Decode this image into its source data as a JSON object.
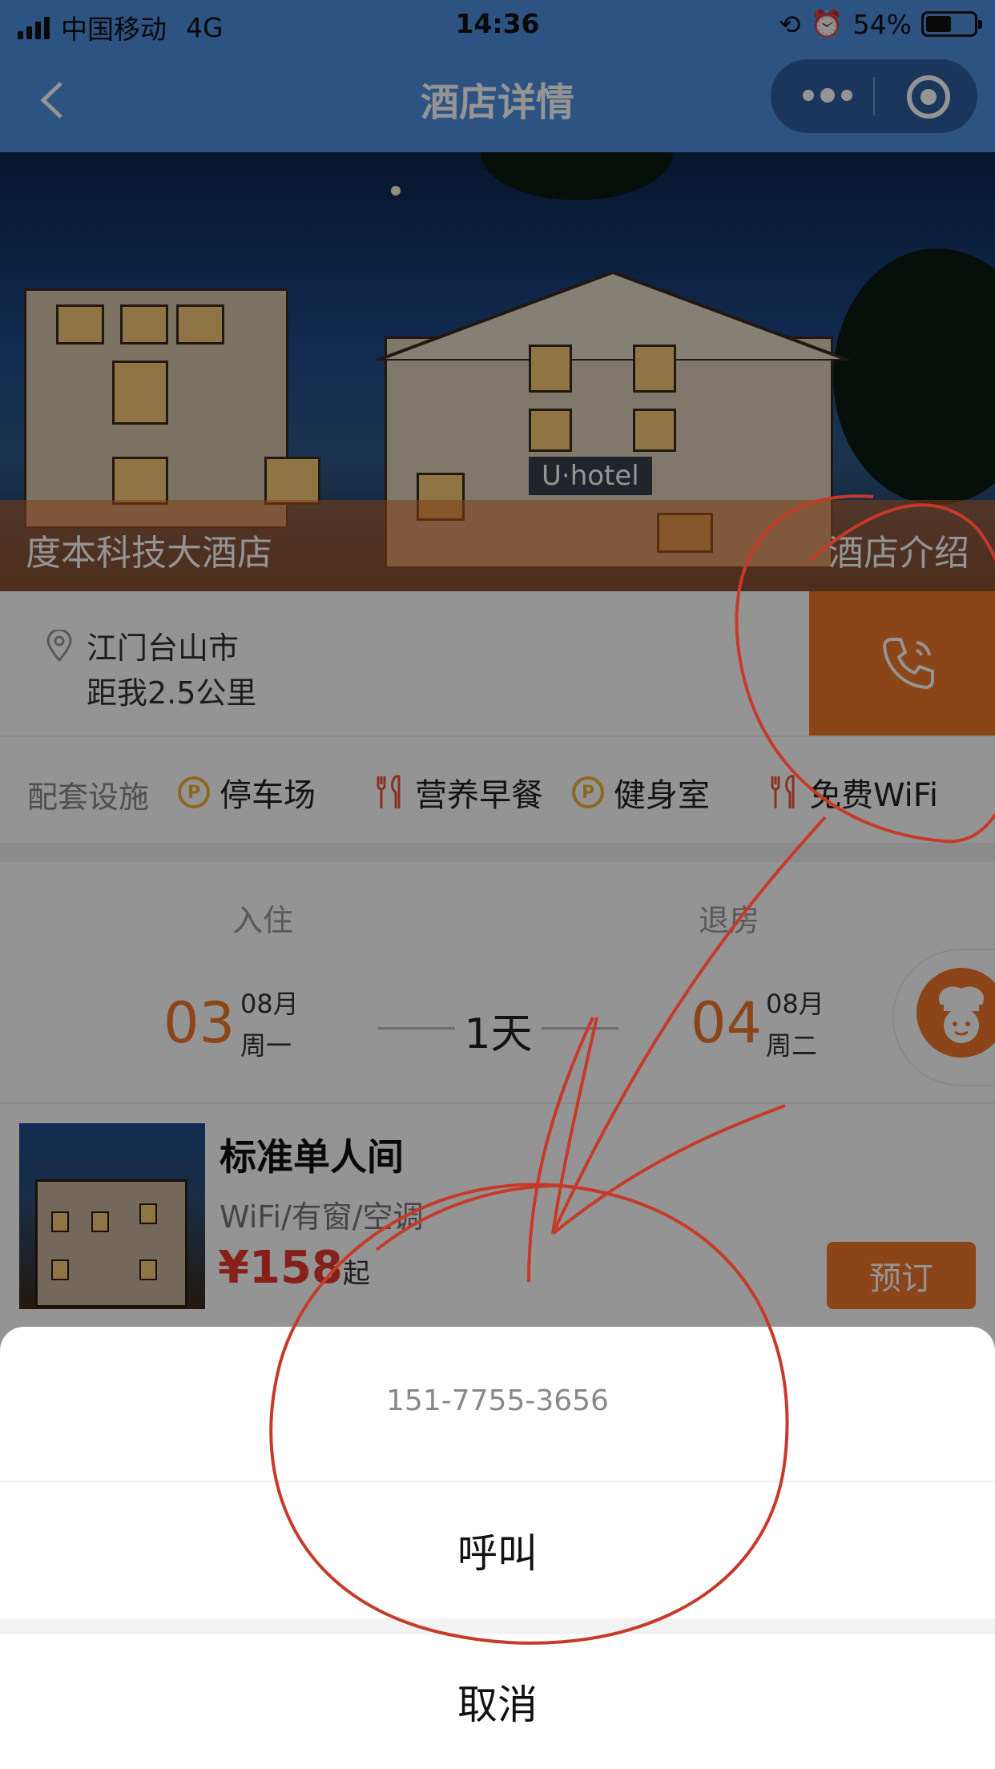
{
  "status_bar": {
    "carrier": "中国移动",
    "network": "4G",
    "time": "14:36",
    "battery_text": "54%",
    "battery_level": 0.54
  },
  "nav": {
    "title": "酒店详情",
    "back_icon": "chevron-left-icon",
    "more_icon": "more-dots-icon",
    "close_icon": "target-circle-icon"
  },
  "hero": {
    "hotel_name": "度本科技大酒店",
    "intro_link": "酒店介绍",
    "sign_text": "U·hotel"
  },
  "location": {
    "city": "江门台山市",
    "distance": "距我2.5公里",
    "call_icon": "phone-call-icon"
  },
  "facilities": {
    "label": "配套设施",
    "items": [
      {
        "label": "停车场",
        "icon": "parking-icon"
      },
      {
        "label": "营养早餐",
        "icon": "fork-knife-icon"
      },
      {
        "label": "健身室",
        "icon": "parking-icon"
      },
      {
        "label": "免费WiFi",
        "icon": "fork-knife-icon"
      }
    ]
  },
  "stay": {
    "checkin_label": "入住",
    "checkout_label": "退房",
    "checkin_day": "03",
    "checkin_month": "08月",
    "checkin_weekday": "周一",
    "nights": "1天",
    "checkout_day": "04",
    "checkout_month": "08月",
    "checkout_weekday": "周二"
  },
  "room": {
    "name": "标准单人间",
    "features": "WiFi/有窗/空调",
    "price": "¥158",
    "price_suffix": "起",
    "book_label": "预订"
  },
  "action_sheet": {
    "phone_number": "151-7755-3656",
    "call_label": "呼叫",
    "cancel_label": "取消"
  },
  "colors": {
    "accent": "#f0782a",
    "price": "#e63a2b",
    "nav_bg": "#4f8fe0",
    "annotation": "#c63a2a"
  }
}
